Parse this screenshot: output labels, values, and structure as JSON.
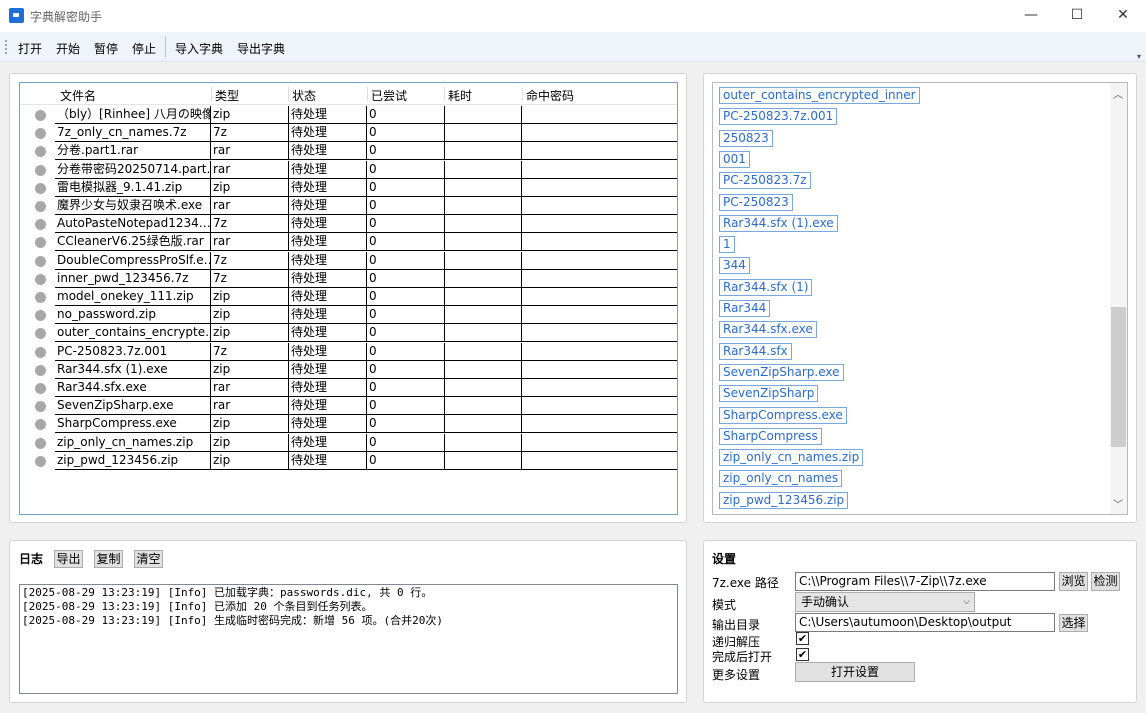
{
  "window": {
    "title": "字典解密助手",
    "minimize_glyph": "—",
    "maximize_glyph": "☐",
    "close_glyph": "✕"
  },
  "menu": {
    "open": "打开",
    "start": "开始",
    "pause": "暂停",
    "stop": "停止",
    "import_dict": "导入字典",
    "export_dict": "导出字典"
  },
  "table": {
    "headers": [
      "文件名",
      "类型",
      "状态",
      "已尝试",
      "耗时",
      "命中密码"
    ],
    "rows": [
      {
        "name": "（bly）[Rinhee] 八月の映像",
        "type": "zip",
        "status": "待处理",
        "tried": "0",
        "time": "",
        "hit": ""
      },
      {
        "name": "7z_only_cn_names.7z",
        "type": "7z",
        "status": "待处理",
        "tried": "0",
        "time": "",
        "hit": ""
      },
      {
        "name": "分卷.part1.rar",
        "type": "rar",
        "status": "待处理",
        "tried": "0",
        "time": "",
        "hit": ""
      },
      {
        "name": "分卷带密码20250714.part…",
        "type": "rar",
        "status": "待处理",
        "tried": "0",
        "time": "",
        "hit": ""
      },
      {
        "name": "雷电模拟器_9.1.41.zip",
        "type": "zip",
        "status": "待处理",
        "tried": "0",
        "time": "",
        "hit": ""
      },
      {
        "name": "魔界少女与奴隶召唤术.exe",
        "type": "rar",
        "status": "待处理",
        "tried": "0",
        "time": "",
        "hit": ""
      },
      {
        "name": "AutoPasteNotepad1234…",
        "type": "7z",
        "status": "待处理",
        "tried": "0",
        "time": "",
        "hit": ""
      },
      {
        "name": "CCleanerV6.25绿色版.rar",
        "type": "rar",
        "status": "待处理",
        "tried": "0",
        "time": "",
        "hit": ""
      },
      {
        "name": "DoubleCompressProSlf.e…",
        "type": "7z",
        "status": "待处理",
        "tried": "0",
        "time": "",
        "hit": ""
      },
      {
        "name": "inner_pwd_123456.7z",
        "type": "7z",
        "status": "待处理",
        "tried": "0",
        "time": "",
        "hit": ""
      },
      {
        "name": "model_onekey_111.zip",
        "type": "zip",
        "status": "待处理",
        "tried": "0",
        "time": "",
        "hit": ""
      },
      {
        "name": "no_password.zip",
        "type": "zip",
        "status": "待处理",
        "tried": "0",
        "time": "",
        "hit": ""
      },
      {
        "name": "outer_contains_encrypte…",
        "type": "zip",
        "status": "待处理",
        "tried": "0",
        "time": "",
        "hit": ""
      },
      {
        "name": "PC-250823.7z.001",
        "type": "7z",
        "status": "待处理",
        "tried": "0",
        "time": "",
        "hit": ""
      },
      {
        "name": "Rar344.sfx (1).exe",
        "type": "zip",
        "status": "待处理",
        "tried": "0",
        "time": "",
        "hit": ""
      },
      {
        "name": "Rar344.sfx.exe",
        "type": "rar",
        "status": "待处理",
        "tried": "0",
        "time": "",
        "hit": ""
      },
      {
        "name": "SevenZipSharp.exe",
        "type": "rar",
        "status": "待处理",
        "tried": "0",
        "time": "",
        "hit": ""
      },
      {
        "name": "SharpCompress.exe",
        "type": "zip",
        "status": "待处理",
        "tried": "0",
        "time": "",
        "hit": ""
      },
      {
        "name": "zip_only_cn_names.zip",
        "type": "zip",
        "status": "待处理",
        "tried": "0",
        "time": "",
        "hit": ""
      },
      {
        "name": "zip_pwd_123456.zip",
        "type": "zip",
        "status": "待处理",
        "tried": "0",
        "time": "",
        "hit": ""
      }
    ]
  },
  "dictionary": {
    "items": [
      "outer_contains_encrypted_inner",
      "PC-250823.7z.001",
      "250823",
      "001",
      "PC-250823.7z",
      "PC-250823",
      "Rar344.sfx (1).exe",
      "1",
      "344",
      "Rar344.sfx (1)",
      "Rar344",
      "Rar344.sfx.exe",
      "Rar344.sfx",
      "SevenZipSharp.exe",
      "SevenZipSharp",
      "SharpCompress.exe",
      "SharpCompress",
      "zip_only_cn_names.zip",
      "zip_only_cn_names",
      "zip_pwd_123456.zip"
    ],
    "scroll_position": 0.8
  },
  "log": {
    "title": "日志",
    "export_label": "导出",
    "copy_label": "复制",
    "clear_label": "清空",
    "lines": [
      "[2025-08-29 13:23:19] [Info] 已加载字典：passwords.dic, 共 0 行。",
      "[2025-08-29 13:23:19] [Info] 已添加 20 个条目到任务列表。",
      "[2025-08-29 13:23:19] [Info] 生成临时密码完成：新增 56 项。(合并20次)"
    ]
  },
  "settings": {
    "title": "设置",
    "sevenzip_label": "7z.exe 路径",
    "sevenzip_path": "C:\\\\Program Files\\\\7-Zip\\\\7z.exe",
    "browse_label": "浏览",
    "detect_label": "检测",
    "mode_label": "模式",
    "mode_value": "手动确认",
    "output_label": "输出目录",
    "output_path": "C:\\Users\\autumoon\\Desktop\\output",
    "select_label": "选择",
    "recursive_label": "递归解压",
    "recursive_checked": true,
    "open_after_label": "完成后打开",
    "open_after_checked": true,
    "more_label": "更多设置",
    "open_settings_label": "打开设置"
  }
}
